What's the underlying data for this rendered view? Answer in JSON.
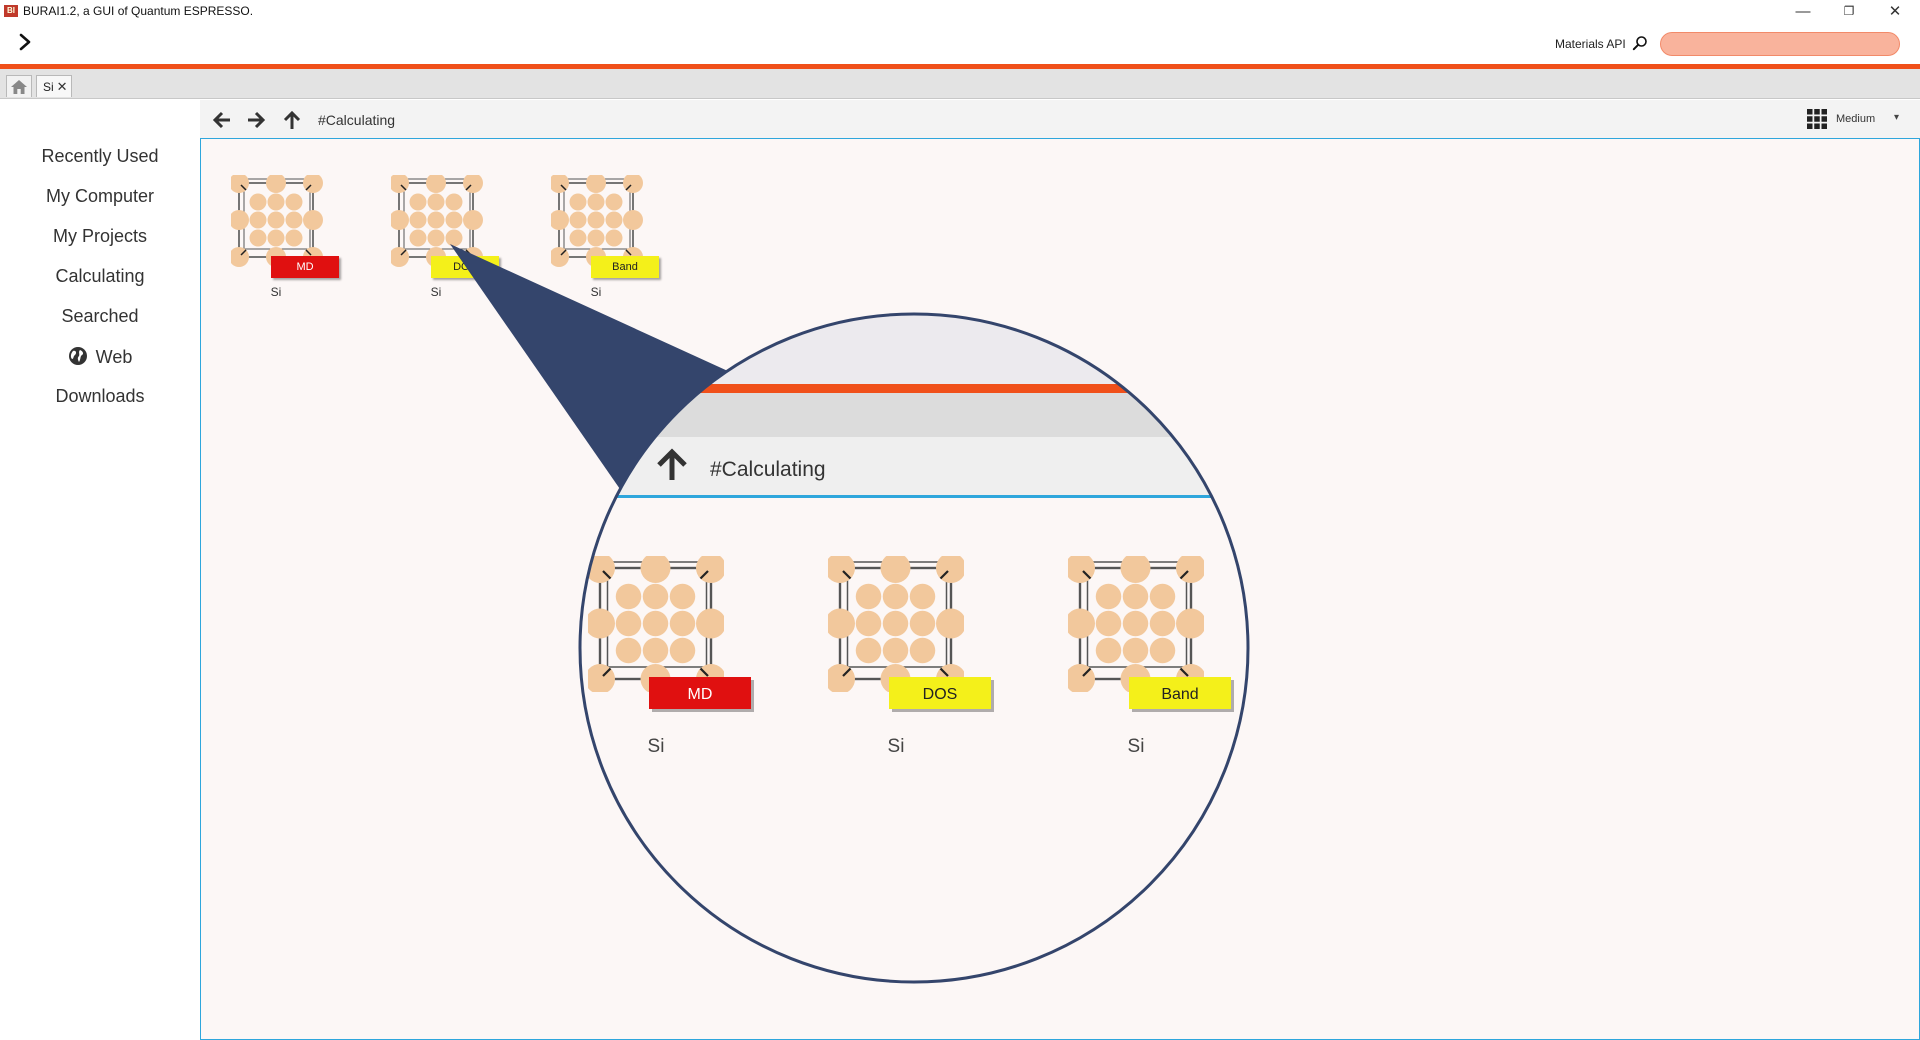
{
  "window": {
    "title": "BURAI1.2, a GUI of Quantum ESPRESSO.",
    "app_icon_text": "BI",
    "minimize_glyph": "—",
    "restore_glyph": "❐",
    "close_glyph": "✕"
  },
  "toolbar": {
    "materials_api_label": "Materials API",
    "search_value": "",
    "accent_color": "#f0501a"
  },
  "tabs": [
    {
      "label": "Si",
      "close": "✕"
    }
  ],
  "nav": {
    "breadcrumb": "#Calculating",
    "view_size": "Medium",
    "caret": "▾"
  },
  "sidebar": {
    "items": [
      {
        "label": "Recently Used"
      },
      {
        "label": "My Computer"
      },
      {
        "label": "My Projects"
      },
      {
        "label": "Calculating"
      },
      {
        "label": "Searched"
      },
      {
        "label": "Web",
        "icon": "globe-icon"
      },
      {
        "label": "Downloads"
      }
    ]
  },
  "files": [
    {
      "name": "Si",
      "tag": "MD",
      "tag_color": "#e01010",
      "tag_text_color": "#ffffff"
    },
    {
      "name": "Si",
      "tag": "DOS",
      "tag_color": "#f4f01a",
      "tag_text_color": "#222222"
    },
    {
      "name": "Si",
      "tag": "Band",
      "tag_color": "#f4f01a",
      "tag_text_color": "#222222"
    }
  ],
  "magnifier": {
    "breadcrumb": "#Calculating",
    "callout_color": "#34456c"
  }
}
